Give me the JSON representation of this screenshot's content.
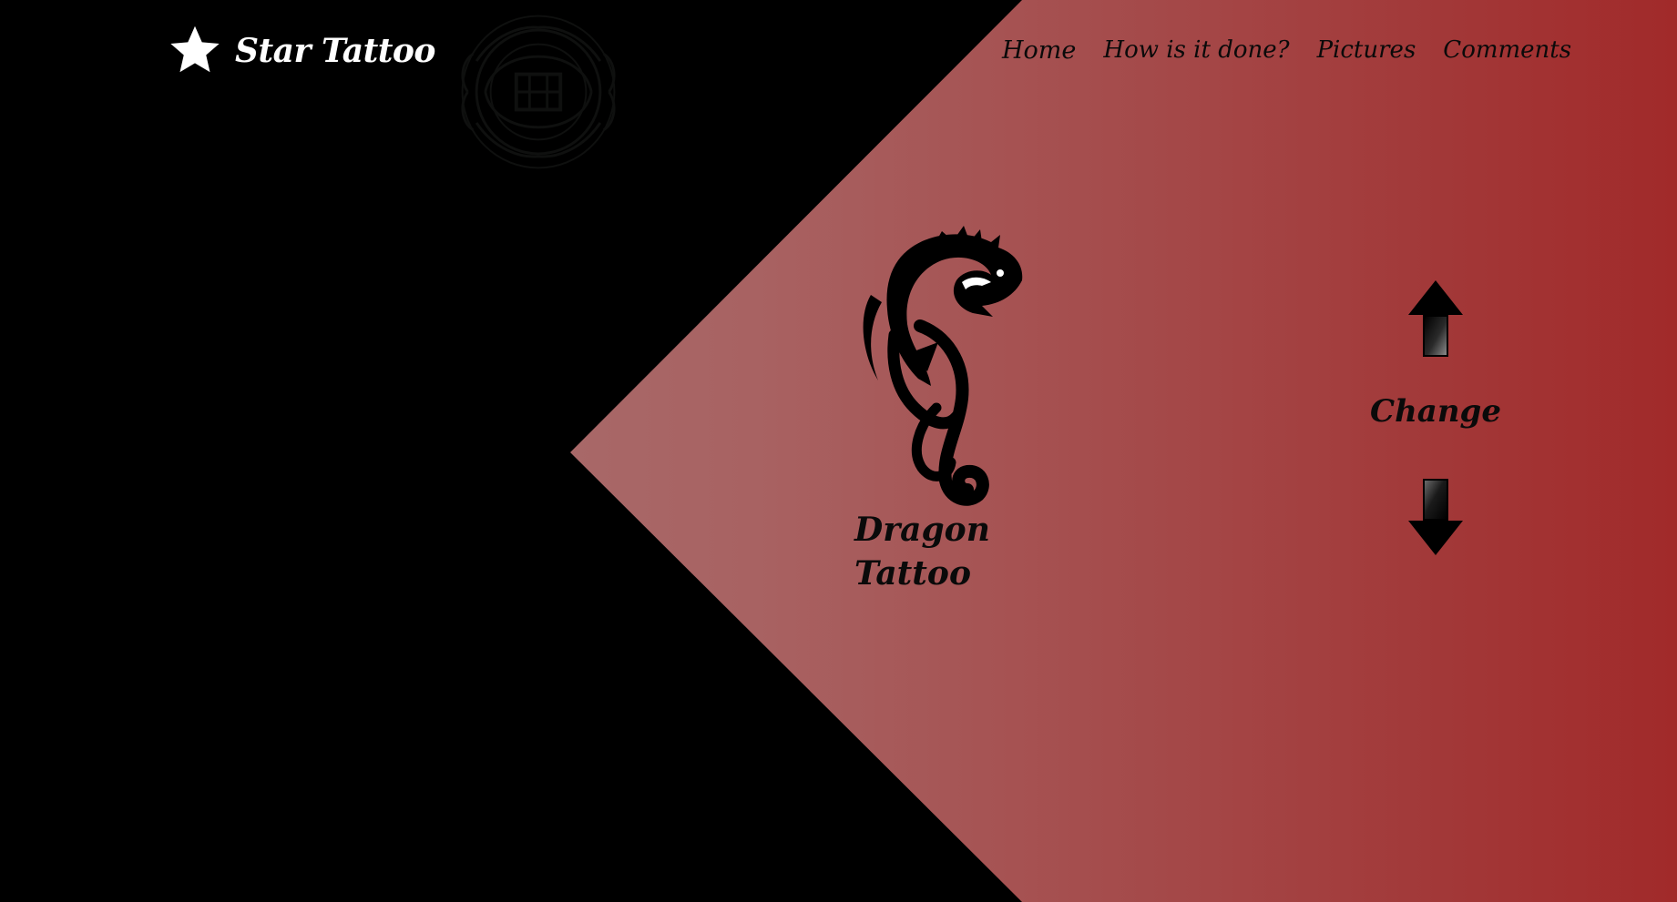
{
  "brand": {
    "name": "Star Tattoo",
    "icon": "star-icon"
  },
  "nav": {
    "items": [
      {
        "label": "Home"
      },
      {
        "label": "How is it done?"
      },
      {
        "label": "Pictures"
      },
      {
        "label": "Comments"
      }
    ]
  },
  "hero": {
    "watermark_icon": "tribal-emblem-icon",
    "tattoo_icon": "dragon-tattoo-icon",
    "tattoo_caption": "Dragon Tattoo"
  },
  "switcher": {
    "label": "Change",
    "up_icon": "arrow-up-icon",
    "down_icon": "arrow-down-icon"
  },
  "colors": {
    "background": "#000000",
    "gradient_start": "#a87a7a",
    "gradient_end": "#a12a2a",
    "brand_text": "#ffffff",
    "dark_text": "#0a0a0a"
  }
}
